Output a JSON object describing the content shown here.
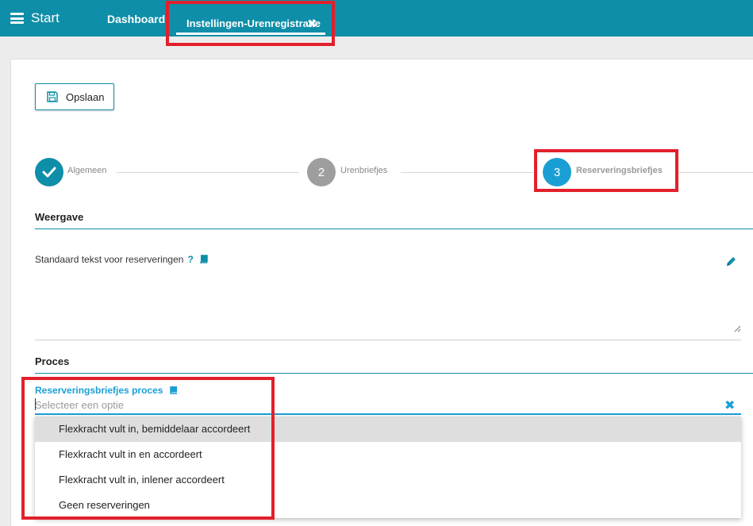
{
  "header": {
    "menu_label": "Start",
    "tabs": [
      {
        "label": "Dashboard"
      },
      {
        "label": "Instellingen-Urenregistratie"
      }
    ]
  },
  "toolbar": {
    "save_label": "Opslaan"
  },
  "steps": [
    {
      "number": "✓",
      "label": "Algemeen",
      "state": "completed"
    },
    {
      "number": "2",
      "label": "Urenbriefjes",
      "state": "inactive"
    },
    {
      "number": "3",
      "label": "Reserveringsbriefjes",
      "state": "active"
    }
  ],
  "sections": {
    "weergave": {
      "title": "Weergave",
      "field_label": "Standaard tekst voor reserveringen",
      "help": "?"
    },
    "proces": {
      "title": "Proces",
      "select_label": "Reserveringsbriefjes proces",
      "select_placeholder": "Selecteer een optie",
      "options": [
        "Flexkracht vult in, bemiddelaar accordeert",
        "Flexkracht vult in en accordeert",
        "Flexkracht vult in, inlener accordeert",
        "Geen reserveringen"
      ]
    }
  },
  "colors": {
    "brand": "#0e8ea8",
    "active_step": "#1a9fd5",
    "inactive_step": "#9e9e9e",
    "highlight": "#e2202c"
  }
}
